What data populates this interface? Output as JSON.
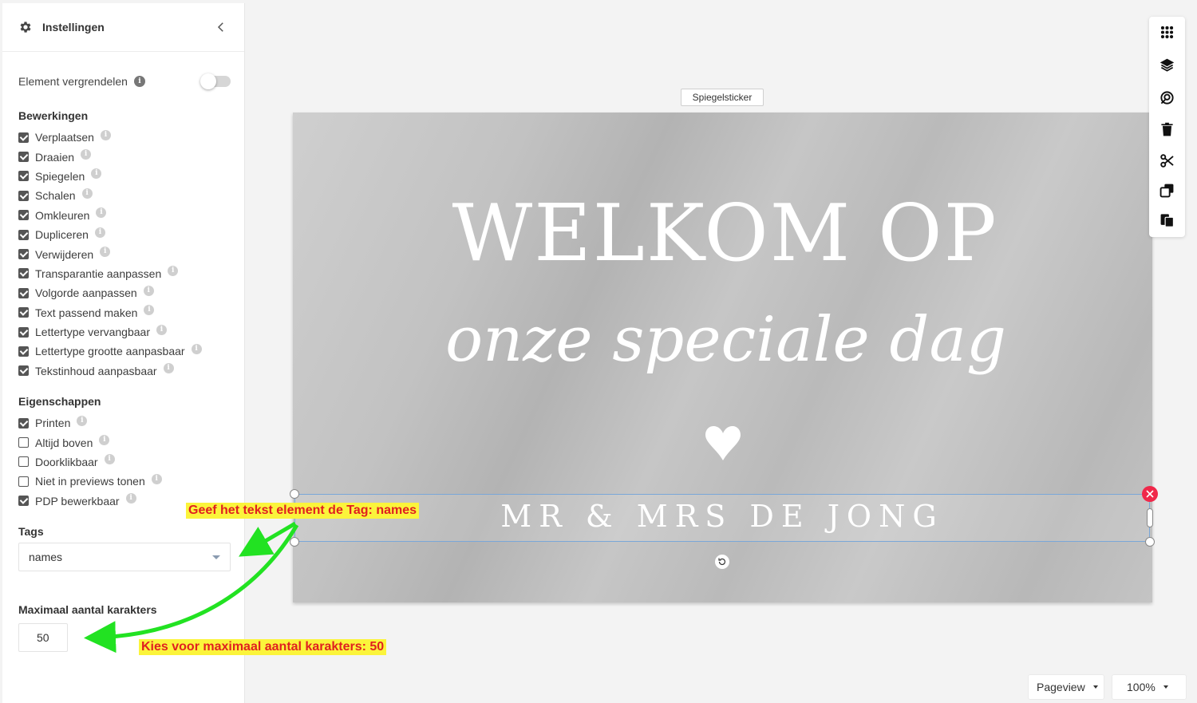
{
  "sidebar": {
    "title": "Instellingen",
    "lock_label": "Element vergrendelen",
    "lock_enabled": false,
    "bewerkingen_title": "Bewerkingen",
    "bewerkingen": [
      {
        "label": "Verplaatsen",
        "checked": true
      },
      {
        "label": "Draaien",
        "checked": true
      },
      {
        "label": "Spiegelen",
        "checked": true
      },
      {
        "label": "Schalen",
        "checked": true
      },
      {
        "label": "Omkleuren",
        "checked": true
      },
      {
        "label": "Dupliceren",
        "checked": true
      },
      {
        "label": "Verwijderen",
        "checked": true
      },
      {
        "label": "Transparantie aanpassen",
        "checked": true
      },
      {
        "label": "Volgorde aanpassen",
        "checked": true
      },
      {
        "label": "Text passend maken",
        "checked": true
      },
      {
        "label": "Lettertype vervangbaar",
        "checked": true
      },
      {
        "label": "Lettertype grootte aanpasbaar",
        "checked": true
      },
      {
        "label": "Tekstinhoud aanpasbaar",
        "checked": true
      }
    ],
    "eigenschappen_title": "Eigenschappen",
    "eigenschappen": [
      {
        "label": "Printen",
        "checked": true
      },
      {
        "label": "Altijd boven",
        "checked": false
      },
      {
        "label": "Doorklikbaar",
        "checked": false
      },
      {
        "label": "Niet in previews tonen",
        "checked": false
      },
      {
        "label": "PDP bewerkbaar",
        "checked": true
      }
    ],
    "tags_title": "Tags",
    "tags_value": "names",
    "max_title": "Maximaal aantal karakters",
    "max_value": "50"
  },
  "canvas": {
    "label": "Spiegelsticker",
    "line1": "WELKOM OP",
    "line2": "onze speciale dag",
    "names": "MR & MRS DE JONG"
  },
  "bottom": {
    "view_label": "Pageview",
    "zoom_label": "100%"
  },
  "annotations": {
    "tag_note": "Geef het tekst element de Tag: names",
    "max_note": "Kies voor maximaal aantal karakters: 50"
  },
  "colors": {
    "annotation_bg": "#fbf43b",
    "annotation_text": "#e02020",
    "arrow": "#22e222",
    "delete": "#f0284a",
    "selection": "#7aa7d8"
  },
  "toolbar_icons": [
    "grid-icon",
    "layers-icon",
    "filter-icon",
    "trash-icon",
    "scissors-icon",
    "copy-icon",
    "paste-icon"
  ]
}
